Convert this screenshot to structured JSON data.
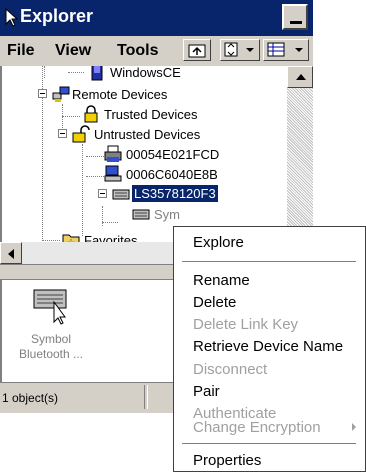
{
  "window": {
    "title": "Explorer"
  },
  "menubar": {
    "items": [
      "File",
      "View",
      "Tools"
    ]
  },
  "tree": {
    "nodes": [
      {
        "label": "WindowsCE",
        "icon": "device-icon"
      },
      {
        "label": "Remote Devices",
        "icon": "network-icon"
      },
      {
        "label": "Trusted Devices",
        "icon": "lock-closed-icon"
      },
      {
        "label": "Untrusted Devices",
        "icon": "lock-open-icon"
      },
      {
        "label": "00054E021FCD",
        "icon": "printer-icon"
      },
      {
        "label": "0006C6040E8B",
        "icon": "computer-icon"
      },
      {
        "label": "LS3578120F3",
        "icon": "keyboard-icon"
      },
      {
        "label": "Sym",
        "icon": "keyboard-icon"
      },
      {
        "label": "Favorites",
        "icon": "favorites-folder-icon"
      }
    ]
  },
  "list": {
    "item_label_line1": "Symbol",
    "item_label_line2": "Bluetooth ..."
  },
  "status": {
    "text": "1 object(s)"
  },
  "context_menu": {
    "items": [
      {
        "label": "Explore",
        "enabled": true
      },
      {
        "label": "Rename",
        "enabled": true
      },
      {
        "label": "Delete",
        "enabled": true
      },
      {
        "label": "Delete Link Key",
        "enabled": false
      },
      {
        "label": "Retrieve Device Name",
        "enabled": true
      },
      {
        "label": "Disconnect",
        "enabled": false
      },
      {
        "label": "Pair",
        "enabled": true
      },
      {
        "label": "Authenticate",
        "enabled": false
      },
      {
        "label": "Change Encryption",
        "enabled": false
      },
      {
        "label": "Properties",
        "enabled": true
      }
    ]
  },
  "colors": {
    "titlebar": "#08246b",
    "selection": "#08246b",
    "chrome": "#d4d0c8",
    "disabled_text": "#a0a0a0"
  }
}
